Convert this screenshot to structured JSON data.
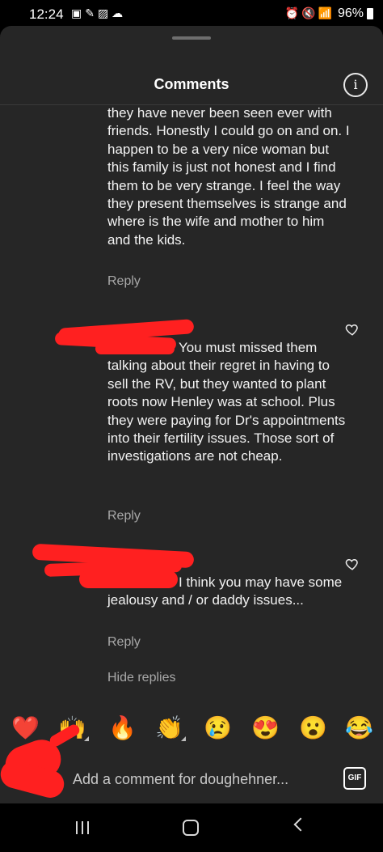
{
  "status_bar": {
    "time": "12:24",
    "battery": "96%"
  },
  "header": {
    "title": "Comments",
    "info_icon": "info-icon"
  },
  "comments": [
    {
      "text": "they have never been seen ever with friends. Honestly I could go on and on. I happen to be a very nice woman but this family is just not honest and I find them to be very strange. I feel the way they present themselves is strange and where is the wife and mother to him and the kids.",
      "reply_label": "Reply"
    },
    {
      "text": "You must missed them talking about their regret in having to sell the RV, but they wanted to plant roots now Henley was at school. Plus they were paying for Dr's appointments into their fertility issues. Those sort of investigations are not cheap.",
      "reply_label": "Reply"
    },
    {
      "text": "I think you may have some jealousy and / or daddy issues...",
      "reply_label": "Reply"
    }
  ],
  "hide_replies": "Hide replies",
  "reactions": [
    "❤️",
    "🙌",
    "🔥",
    "👏",
    "😢",
    "😍",
    "😮",
    "😂"
  ],
  "composer": {
    "placeholder": "Add a comment for doughehner...",
    "gif_label": "GIF"
  },
  "colors": {
    "sheet_bg": "#262626",
    "secondary_text": "#a8a8a8",
    "redaction": "#ff2020"
  }
}
